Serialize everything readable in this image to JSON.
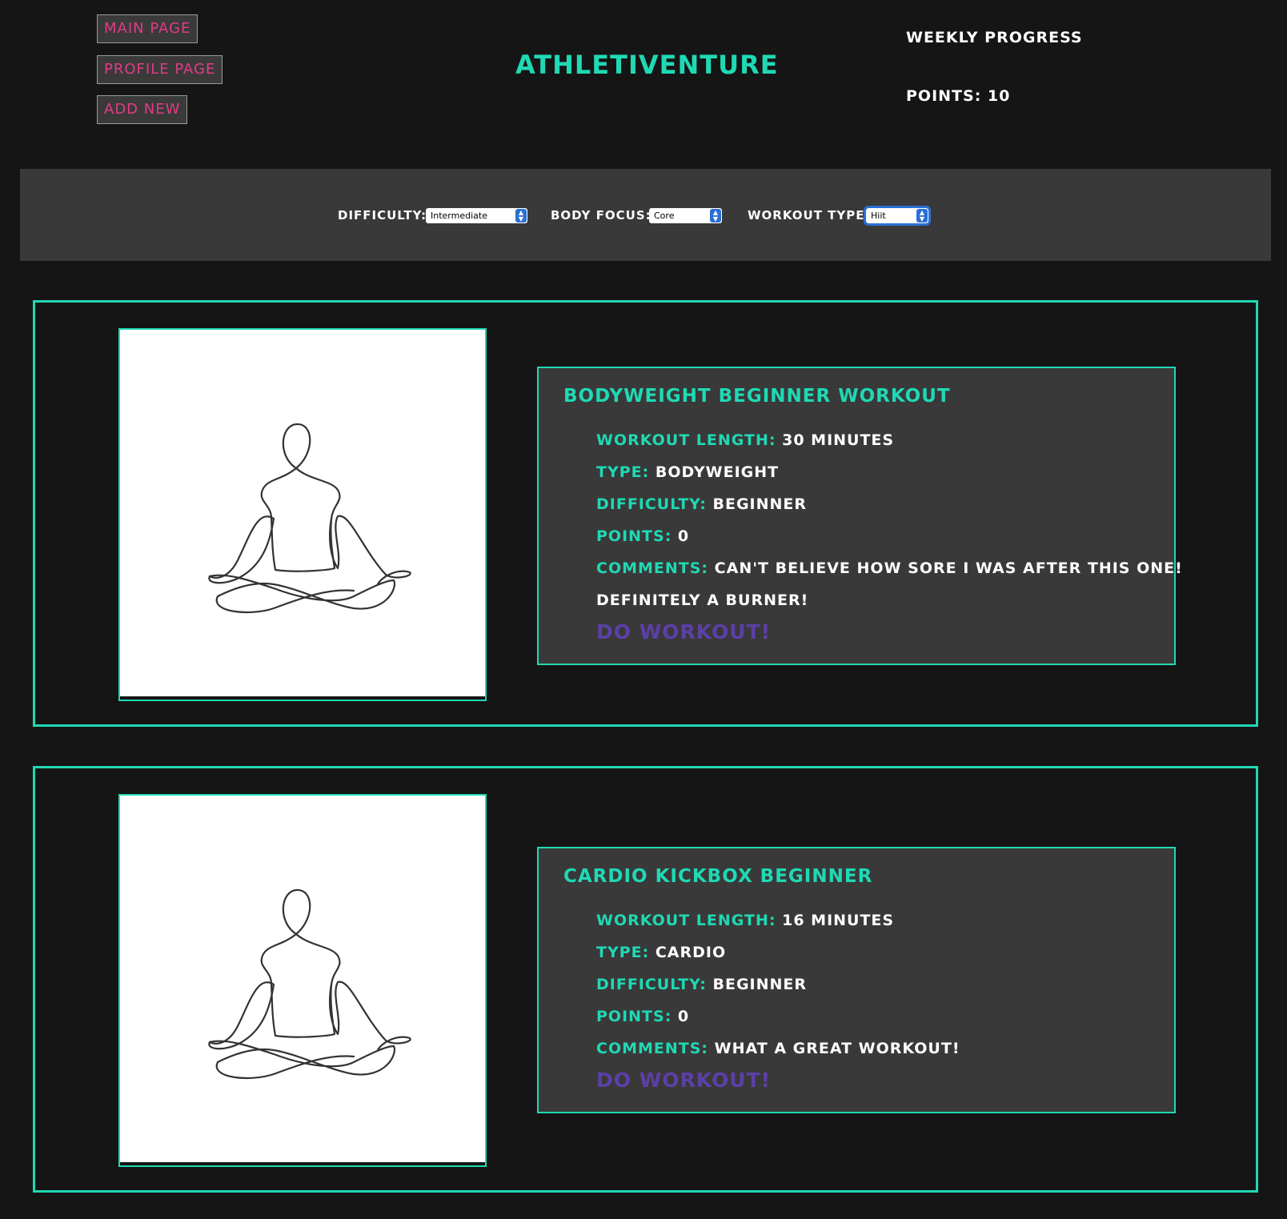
{
  "nav": {
    "main_page": "Main Page",
    "profile_page": "Profile Page",
    "add_new": "Add New"
  },
  "header": {
    "title": "Athletiventure",
    "weekly_progress": "Weekly Progress",
    "points": "Points: 10"
  },
  "filters": {
    "difficulty_label": "Difficulty:",
    "difficulty_value": "Intermediate",
    "body_focus_label": "Body Focus:",
    "body_focus_value": "Core",
    "workout_type_label": "Workout Type:",
    "workout_type_value": "Hiit"
  },
  "workouts": [
    {
      "title": "Bodyweight Beginner Workout",
      "length_label": "Workout Length:",
      "length": "30 minutes",
      "type_label": "Type:",
      "type": "Bodyweight",
      "difficulty_label": "Difficulty:",
      "difficulty": "Beginner",
      "points_label": "Points:",
      "points": "0",
      "comments_label": "Comments:",
      "comments_line1": "Can't believe how sore I was after this one!",
      "comments_line2": "Definitely a burner!",
      "action": "Do Workout!",
      "image_icon": "meditation-line-art-icon"
    },
    {
      "title": "Cardio Kickbox Beginner",
      "length_label": "Workout Length:",
      "length": "16 minutes",
      "type_label": "Type:",
      "type": "Cardio",
      "difficulty_label": "Difficulty:",
      "difficulty": "Beginner",
      "points_label": "Points:",
      "points": "0",
      "comments_label": "Comments:",
      "comments_line1": "What a great workout!",
      "action": "Do Workout!",
      "image_icon": "meditation-line-art-icon"
    }
  ],
  "colors": {
    "background": "#151515",
    "panel": "#393939",
    "accent_teal": "#1fd9b4",
    "nav_pink": "#e33a86",
    "action_purple": "#5c3fa8",
    "select_blue": "#2b6fd6"
  }
}
